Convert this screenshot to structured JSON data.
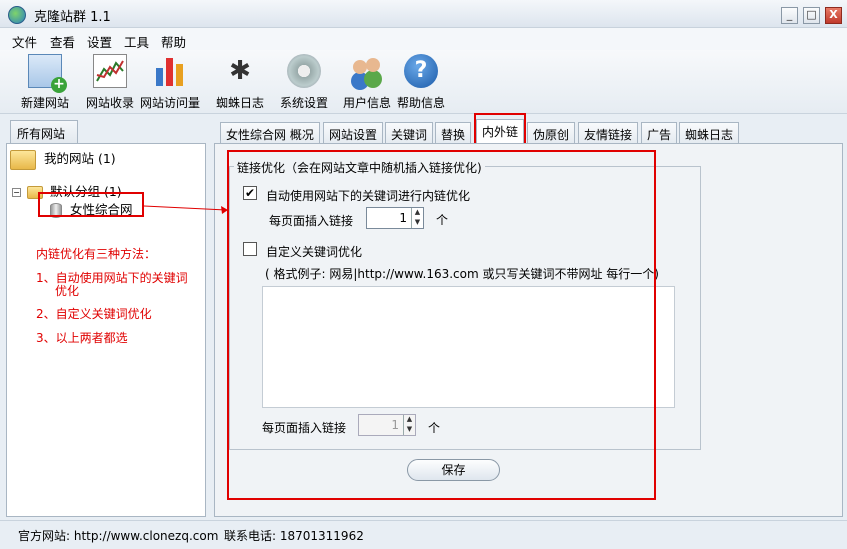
{
  "window": {
    "title": "克隆站群 1.1",
    "buttons": {
      "minimize": "_",
      "maximize": "□",
      "close": "X"
    }
  },
  "menu": [
    "文件",
    "查看",
    "设置",
    "工具",
    "帮助"
  ],
  "toolbar": [
    {
      "label": "新建网站",
      "icon": "new-site-icon"
    },
    {
      "label": "网站收录",
      "icon": "index-chart-icon"
    },
    {
      "label": "网站访问量",
      "icon": "bar-chart-icon"
    },
    {
      "label": "蜘蛛日志",
      "icon": "spider-icon"
    },
    {
      "label": "系统设置",
      "icon": "gear-icon"
    },
    {
      "label": "用户信息",
      "icon": "users-icon"
    },
    {
      "label": "帮助信息",
      "icon": "help-icon"
    }
  ],
  "sidebar": {
    "tab": "所有网站",
    "root": "我的网站 (1)",
    "group": "默认分组 (1)",
    "site": "女性综合网",
    "notes": [
      "内链优化有三种方法：",
      "1、自动使用网站下的关键词",
      "优化",
      "2、自定义关键词优化",
      "3、以上两者都选"
    ]
  },
  "tabs": [
    "女性综合网 概况",
    "网站设置",
    "关键词",
    "替换",
    "内外链",
    "伪原创",
    "友情链接",
    "广告",
    "蜘蛛日志"
  ],
  "active_tab": "内外链",
  "link_opt": {
    "group_title": "链接优化（会在网站文章中随机插入链接优化)",
    "auto_label": "自动使用网站下的关键词进行内链优化",
    "auto_checked": "✔",
    "per_page_label": "每页面插入链接",
    "per_page_value": "1",
    "unit": "个",
    "custom_label": "自定义关键词优化",
    "format_hint": "( 格式例子: 网易|http://www.163.com 或只写关键词不带网址  每行一个)",
    "custom_per_page_label": "每页面插入链接",
    "custom_per_page_value": "1",
    "custom_unit": "个",
    "save": "保存"
  },
  "status": {
    "website": "官方网站: http://www.clonezq.com",
    "phone": "联系电话: 18701311962"
  },
  "accent": "#e00000"
}
